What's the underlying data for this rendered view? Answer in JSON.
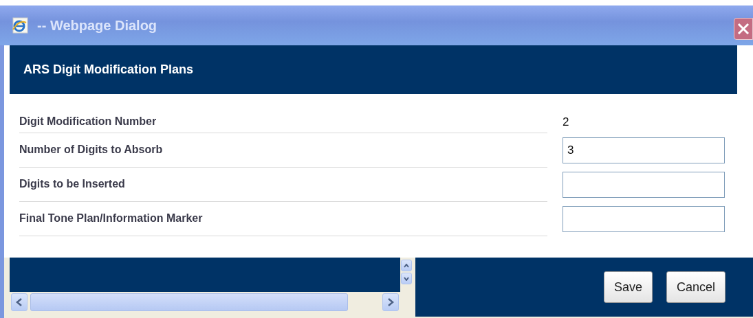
{
  "window": {
    "title": "-- Webpage Dialog"
  },
  "header": {
    "title": "ARS Digit Modification Plans"
  },
  "fields": [
    {
      "label": "Digit Modification Number",
      "kind": "text",
      "value": "2"
    },
    {
      "label": "Number of Digits to Absorb",
      "kind": "input",
      "value": "3"
    },
    {
      "label": "Digits to be Inserted",
      "kind": "input"
    },
    {
      "label": "Final Tone Plan/Information Marker",
      "kind": "input"
    }
  ],
  "buttons": [
    "Save",
    "Cancel"
  ]
}
